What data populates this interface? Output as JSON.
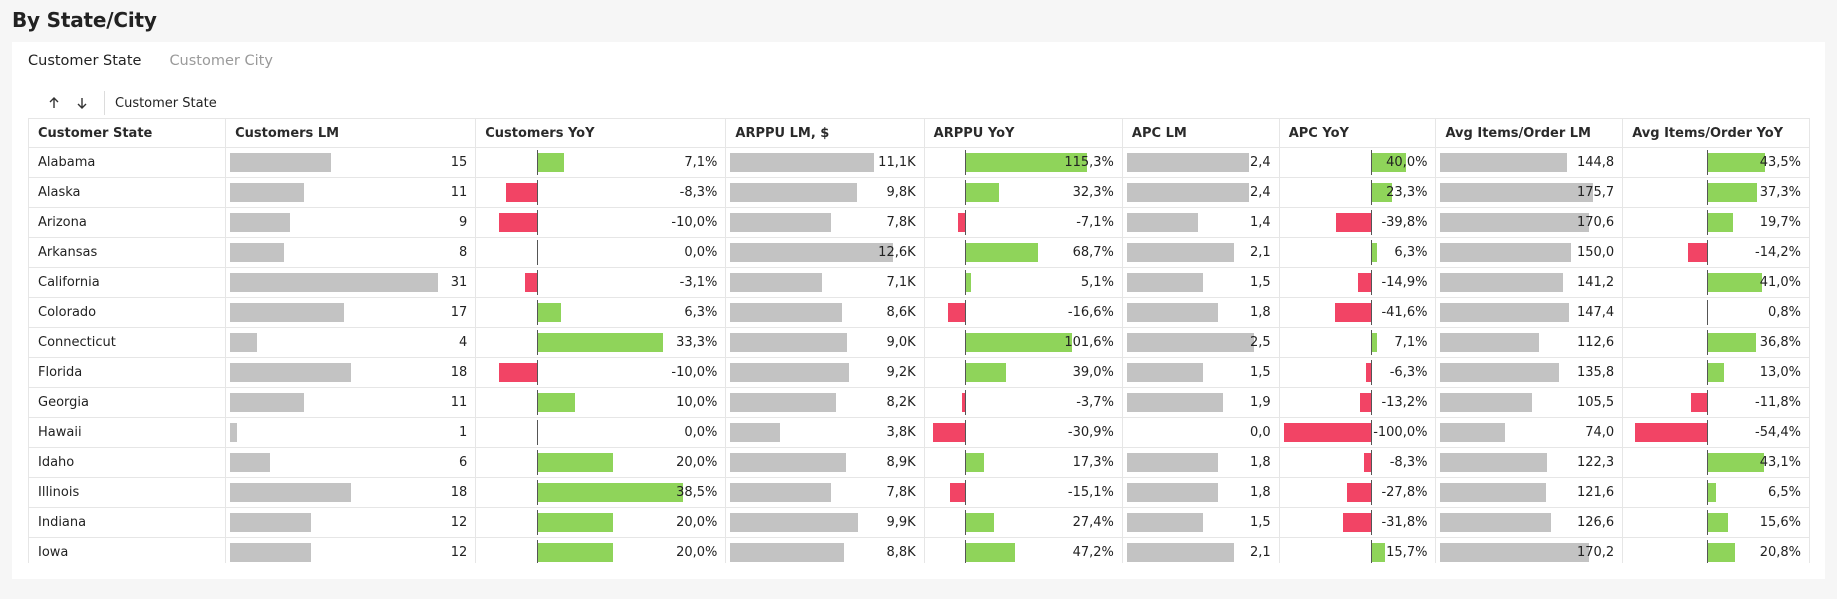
{
  "page": {
    "title": "By State/City"
  },
  "tabs": [
    {
      "label": "Customer State",
      "active": true
    },
    {
      "label": "Customer City",
      "active": false
    }
  ],
  "toolbar": {
    "sort_asc_icon": "arrow-up-icon",
    "sort_desc_icon": "arrow-down-icon",
    "group_label": "Customer State"
  },
  "colors": {
    "gray_bar": "#c3c3c3",
    "positive": "#8fd45a",
    "negative": "#f24465"
  },
  "table": {
    "headers": [
      "Customer State",
      "Customers LM",
      "Customers YoY",
      "ARPPU LM, $",
      "ARPPU YoY",
      "APC LM",
      "APC YoY",
      "Avg Items/Order LM",
      "Avg Items/Order YoY"
    ],
    "scales": {
      "cust_lm_max": 31,
      "cust_yoy": {
        "min": -0.15,
        "max": 0.4
      },
      "arppu_lm_max": 12.6,
      "arppu_yoy": {
        "min": -0.35,
        "max": 1.2
      },
      "apc_lm_max": 2.5,
      "apc_yoy": {
        "min": -1.0,
        "max": 0.45
      },
      "items_lm_max": 175.7,
      "items_yoy": {
        "min": -0.6,
        "max": 0.55
      }
    },
    "rows": [
      {
        "state": "Alabama",
        "cust_lm": 15,
        "cust_lm_text": "15",
        "cust_yoy": 0.071,
        "cust_yoy_text": "7,1%",
        "arppu_lm": 11.1,
        "arppu_lm_text": "11,1K",
        "arppu_yoy": 1.153,
        "arppu_yoy_text": "115,3%",
        "apc_lm": 2.4,
        "apc_lm_text": "2,4",
        "apc_yoy": 0.4,
        "apc_yoy_text": "40,0%",
        "items_lm": 144.8,
        "items_lm_text": "144,8",
        "items_yoy": 0.435,
        "items_yoy_text": "43,5%"
      },
      {
        "state": "Alaska",
        "cust_lm": 11,
        "cust_lm_text": "11",
        "cust_yoy": -0.083,
        "cust_yoy_text": "-8,3%",
        "arppu_lm": 9.8,
        "arppu_lm_text": "9,8K",
        "arppu_yoy": 0.323,
        "arppu_yoy_text": "32,3%",
        "apc_lm": 2.4,
        "apc_lm_text": "2,4",
        "apc_yoy": 0.233,
        "apc_yoy_text": "23,3%",
        "items_lm": 175.7,
        "items_lm_text": "175,7",
        "items_yoy": 0.373,
        "items_yoy_text": "37,3%"
      },
      {
        "state": "Arizona",
        "cust_lm": 9,
        "cust_lm_text": "9",
        "cust_yoy": -0.1,
        "cust_yoy_text": "-10,0%",
        "arppu_lm": 7.8,
        "arppu_lm_text": "7,8K",
        "arppu_yoy": -0.071,
        "arppu_yoy_text": "-7,1%",
        "apc_lm": 1.4,
        "apc_lm_text": "1,4",
        "apc_yoy": -0.398,
        "apc_yoy_text": "-39,8%",
        "items_lm": 170.6,
        "items_lm_text": "170,6",
        "items_yoy": 0.197,
        "items_yoy_text": "19,7%"
      },
      {
        "state": "Arkansas",
        "cust_lm": 8,
        "cust_lm_text": "8",
        "cust_yoy": 0.0,
        "cust_yoy_text": "0,0%",
        "arppu_lm": 12.6,
        "arppu_lm_text": "12,6K",
        "arppu_yoy": 0.687,
        "arppu_yoy_text": "68,7%",
        "apc_lm": 2.1,
        "apc_lm_text": "2,1",
        "apc_yoy": 0.063,
        "apc_yoy_text": "6,3%",
        "items_lm": 150.0,
        "items_lm_text": "150,0",
        "items_yoy": -0.142,
        "items_yoy_text": "-14,2%"
      },
      {
        "state": "California",
        "cust_lm": 31,
        "cust_lm_text": "31",
        "cust_yoy": -0.031,
        "cust_yoy_text": "-3,1%",
        "arppu_lm": 7.1,
        "arppu_lm_text": "7,1K",
        "arppu_yoy": 0.051,
        "arppu_yoy_text": "5,1%",
        "apc_lm": 1.5,
        "apc_lm_text": "1,5",
        "apc_yoy": -0.149,
        "apc_yoy_text": "-14,9%",
        "items_lm": 141.2,
        "items_lm_text": "141,2",
        "items_yoy": 0.41,
        "items_yoy_text": "41,0%"
      },
      {
        "state": "Colorado",
        "cust_lm": 17,
        "cust_lm_text": "17",
        "cust_yoy": 0.063,
        "cust_yoy_text": "6,3%",
        "arppu_lm": 8.6,
        "arppu_lm_text": "8,6K",
        "arppu_yoy": -0.166,
        "arppu_yoy_text": "-16,6%",
        "apc_lm": 1.8,
        "apc_lm_text": "1,8",
        "apc_yoy": -0.416,
        "apc_yoy_text": "-41,6%",
        "items_lm": 147.4,
        "items_lm_text": "147,4",
        "items_yoy": 0.008,
        "items_yoy_text": "0,8%"
      },
      {
        "state": "Connecticut",
        "cust_lm": 4,
        "cust_lm_text": "4",
        "cust_yoy": 0.333,
        "cust_yoy_text": "33,3%",
        "arppu_lm": 9.0,
        "arppu_lm_text": "9,0K",
        "arppu_yoy": 1.016,
        "arppu_yoy_text": "101,6%",
        "apc_lm": 2.5,
        "apc_lm_text": "2,5",
        "apc_yoy": 0.071,
        "apc_yoy_text": "7,1%",
        "items_lm": 112.6,
        "items_lm_text": "112,6",
        "items_yoy": 0.368,
        "items_yoy_text": "36,8%"
      },
      {
        "state": "Florida",
        "cust_lm": 18,
        "cust_lm_text": "18",
        "cust_yoy": -0.1,
        "cust_yoy_text": "-10,0%",
        "arppu_lm": 9.2,
        "arppu_lm_text": "9,2K",
        "arppu_yoy": 0.39,
        "arppu_yoy_text": "39,0%",
        "apc_lm": 1.5,
        "apc_lm_text": "1,5",
        "apc_yoy": -0.063,
        "apc_yoy_text": "-6,3%",
        "items_lm": 135.8,
        "items_lm_text": "135,8",
        "items_yoy": 0.13,
        "items_yoy_text": "13,0%"
      },
      {
        "state": "Georgia",
        "cust_lm": 11,
        "cust_lm_text": "11",
        "cust_yoy": 0.1,
        "cust_yoy_text": "10,0%",
        "arppu_lm": 8.2,
        "arppu_lm_text": "8,2K",
        "arppu_yoy": -0.037,
        "arppu_yoy_text": "-3,7%",
        "apc_lm": 1.9,
        "apc_lm_text": "1,9",
        "apc_yoy": -0.132,
        "apc_yoy_text": "-13,2%",
        "items_lm": 105.5,
        "items_lm_text": "105,5",
        "items_yoy": -0.118,
        "items_yoy_text": "-11,8%"
      },
      {
        "state": "Hawaii",
        "cust_lm": 1,
        "cust_lm_text": "1",
        "cust_yoy": 0.0,
        "cust_yoy_text": "0,0%",
        "arppu_lm": 3.8,
        "arppu_lm_text": "3,8K",
        "arppu_yoy": -0.309,
        "arppu_yoy_text": "-30,9%",
        "apc_lm": 0.0,
        "apc_lm_text": "0,0",
        "apc_yoy": -1.0,
        "apc_yoy_text": "-100,0%",
        "items_lm": 74.0,
        "items_lm_text": "74,0",
        "items_yoy": -0.544,
        "items_yoy_text": "-54,4%"
      },
      {
        "state": "Idaho",
        "cust_lm": 6,
        "cust_lm_text": "6",
        "cust_yoy": 0.2,
        "cust_yoy_text": "20,0%",
        "arppu_lm": 8.9,
        "arppu_lm_text": "8,9K",
        "arppu_yoy": 0.173,
        "arppu_yoy_text": "17,3%",
        "apc_lm": 1.8,
        "apc_lm_text": "1,8",
        "apc_yoy": -0.083,
        "apc_yoy_text": "-8,3%",
        "items_lm": 122.3,
        "items_lm_text": "122,3",
        "items_yoy": 0.431,
        "items_yoy_text": "43,1%"
      },
      {
        "state": "Illinois",
        "cust_lm": 18,
        "cust_lm_text": "18",
        "cust_yoy": 0.385,
        "cust_yoy_text": "38,5%",
        "arppu_lm": 7.8,
        "arppu_lm_text": "7,8K",
        "arppu_yoy": -0.151,
        "arppu_yoy_text": "-15,1%",
        "apc_lm": 1.8,
        "apc_lm_text": "1,8",
        "apc_yoy": -0.278,
        "apc_yoy_text": "-27,8%",
        "items_lm": 121.6,
        "items_lm_text": "121,6",
        "items_yoy": 0.065,
        "items_yoy_text": "6,5%"
      },
      {
        "state": "Indiana",
        "cust_lm": 12,
        "cust_lm_text": "12",
        "cust_yoy": 0.2,
        "cust_yoy_text": "20,0%",
        "arppu_lm": 9.9,
        "arppu_lm_text": "9,9K",
        "arppu_yoy": 0.274,
        "arppu_yoy_text": "27,4%",
        "apc_lm": 1.5,
        "apc_lm_text": "1,5",
        "apc_yoy": -0.318,
        "apc_yoy_text": "-31,8%",
        "items_lm": 126.6,
        "items_lm_text": "126,6",
        "items_yoy": 0.156,
        "items_yoy_text": "15,6%"
      },
      {
        "state": "Iowa",
        "cust_lm": 12,
        "cust_lm_text": "12",
        "cust_yoy": 0.2,
        "cust_yoy_text": "20,0%",
        "arppu_lm": 8.8,
        "arppu_lm_text": "8,8K",
        "arppu_yoy": 0.472,
        "arppu_yoy_text": "47,2%",
        "apc_lm": 2.1,
        "apc_lm_text": "2,1",
        "apc_yoy": 0.157,
        "apc_yoy_text": "15,7%",
        "items_lm": 170.2,
        "items_lm_text": "170,2",
        "items_yoy": 0.208,
        "items_yoy_text": "20,8%"
      }
    ]
  }
}
